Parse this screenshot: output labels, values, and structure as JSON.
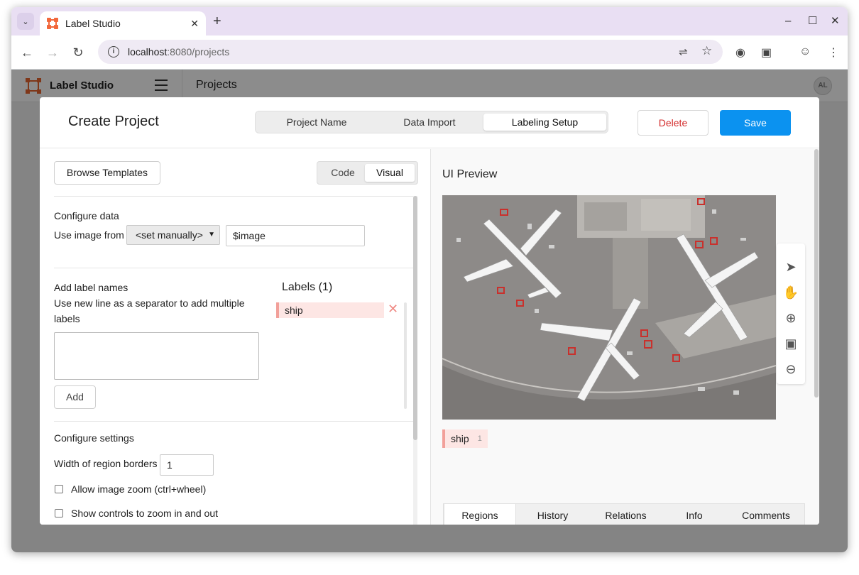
{
  "browser": {
    "tab_title": "Label Studio",
    "url_host": "localhost",
    "url_path": ":8080/projects",
    "window_controls": [
      "–",
      "☐",
      "✕"
    ]
  },
  "app": {
    "name": "Label Studio",
    "page_title": "Projects",
    "avatar_initials": "AL"
  },
  "modal": {
    "title": "Create Project",
    "steps": [
      {
        "label": "Project Name",
        "active": false
      },
      {
        "label": "Data Import",
        "active": false
      },
      {
        "label": "Labeling Setup",
        "active": true
      }
    ],
    "delete_label": "Delete",
    "save_label": "Save"
  },
  "left": {
    "browse_templates": "Browse Templates",
    "view_toggle": {
      "options": [
        "Code",
        "Visual"
      ],
      "selected": "Visual"
    },
    "configure_data": {
      "title": "Configure data",
      "use_image_from": "Use image from",
      "select_value": "<set manually>",
      "field_value": "$image"
    },
    "add_labels": {
      "title": "Add label names",
      "hint": "Use new line as a separator to add multiple labels",
      "textarea_value": "",
      "add_button": "Add"
    },
    "labels": {
      "title": "Labels (1)",
      "items": [
        {
          "name": "ship",
          "color": "#f2a09a"
        }
      ]
    },
    "configure_settings": {
      "title": "Configure settings",
      "border_width_label": "Width of region borders",
      "border_width_value": "1",
      "zoom_checkbox": "Allow image zoom (ctrl+wheel)",
      "zoom_controls_checkbox": "Show controls to zoom in and out"
    }
  },
  "right": {
    "title": "UI Preview",
    "image_alt": "aerial view of airplanes at airport gates",
    "tools": [
      "select-pointer-icon",
      "pan-hand-icon",
      "zoom-in-icon",
      "fit-icon",
      "zoom-out-icon"
    ],
    "labels": [
      {
        "name": "ship",
        "count": "1"
      }
    ],
    "tabs": [
      "Regions",
      "History",
      "Relations",
      "Info",
      "Comments"
    ],
    "active_tab": "Regions"
  },
  "colors": {
    "accent": "#0b92f0",
    "danger": "#d32a2a",
    "brand": "#e8652e",
    "label_ship": "#f2a09a"
  }
}
